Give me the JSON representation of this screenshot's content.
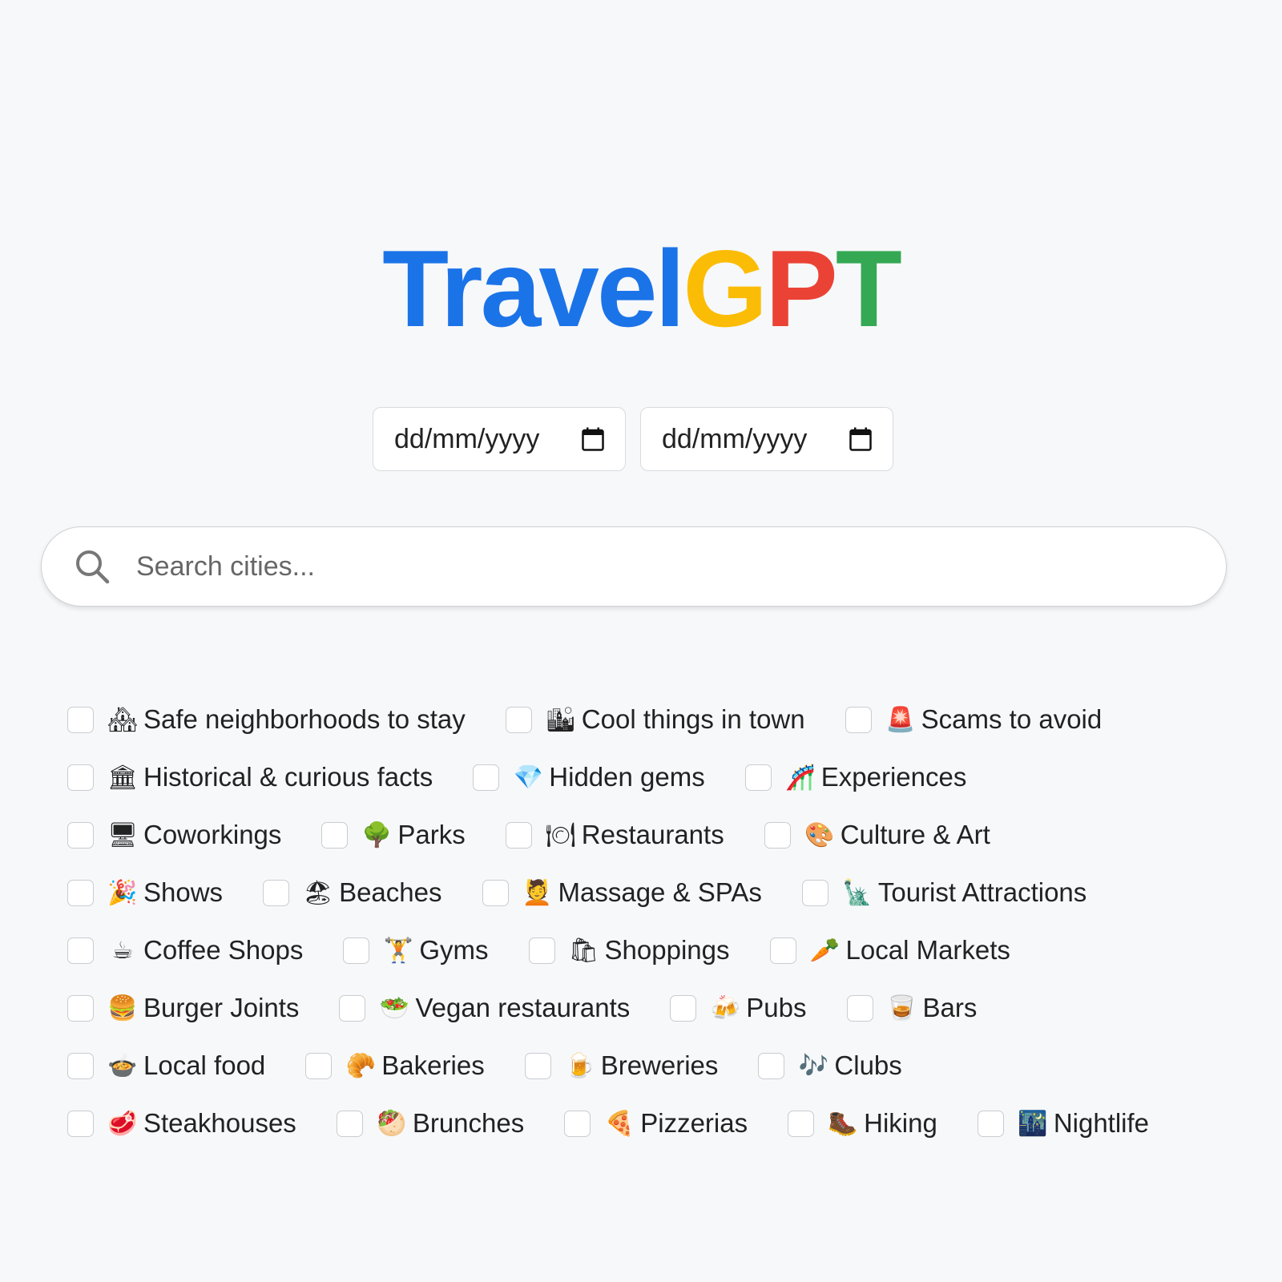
{
  "title": {
    "part1": "Travel",
    "part2": "G",
    "part3": "P",
    "part4": "T"
  },
  "colors": {
    "blue": "#1b73e8",
    "yellow": "#fbbc05",
    "red": "#ea4335",
    "green": "#34a853"
  },
  "dates": {
    "start_placeholder": "dd/mm/yyyy",
    "end_placeholder": "dd/mm/yyyy"
  },
  "search": {
    "placeholder": "Search cities..."
  },
  "options": [
    [
      {
        "emoji": "🏘",
        "label": "Safe neighborhoods to stay"
      },
      {
        "emoji": "🏙",
        "label": "Cool things in town"
      },
      {
        "emoji": "🚨",
        "label": "Scams to avoid"
      }
    ],
    [
      {
        "emoji": "🏛",
        "label": "Historical & curious facts"
      },
      {
        "emoji": "💎",
        "label": "Hidden gems"
      },
      {
        "emoji": "🎢",
        "label": "Experiences"
      }
    ],
    [
      {
        "emoji": "🖥",
        "label": "Coworkings"
      },
      {
        "emoji": "🌳",
        "label": "Parks"
      },
      {
        "emoji": "🍽",
        "label": "Restaurants"
      },
      {
        "emoji": "🎨",
        "label": "Culture & Art"
      }
    ],
    [
      {
        "emoji": "🎉",
        "label": "Shows"
      },
      {
        "emoji": "🏖",
        "label": "Beaches"
      },
      {
        "emoji": "💆",
        "label": "Massage & SPAs"
      },
      {
        "emoji": "🗽",
        "label": "Tourist Attractions"
      }
    ],
    [
      {
        "emoji": "☕",
        "label": "Coffee Shops"
      },
      {
        "emoji": "🏋",
        "label": "Gyms"
      },
      {
        "emoji": "🛍",
        "label": "Shoppings"
      },
      {
        "emoji": "🥕",
        "label": "Local Markets"
      }
    ],
    [
      {
        "emoji": "🍔",
        "label": "Burger Joints"
      },
      {
        "emoji": "🥗",
        "label": "Vegan restaurants"
      },
      {
        "emoji": "🍻",
        "label": "Pubs"
      },
      {
        "emoji": "🥃",
        "label": "Bars"
      }
    ],
    [
      {
        "emoji": "🍲",
        "label": "Local food"
      },
      {
        "emoji": "🥐",
        "label": "Bakeries"
      },
      {
        "emoji": "🍺",
        "label": "Breweries"
      },
      {
        "emoji": "🎶",
        "label": "Clubs"
      }
    ],
    [
      {
        "emoji": "🥩",
        "label": "Steakhouses"
      },
      {
        "emoji": "🥙",
        "label": "Brunches"
      },
      {
        "emoji": "🍕",
        "label": "Pizzerias"
      },
      {
        "emoji": "🥾",
        "label": "Hiking"
      },
      {
        "emoji": "🌃",
        "label": "Nightlife"
      }
    ]
  ]
}
